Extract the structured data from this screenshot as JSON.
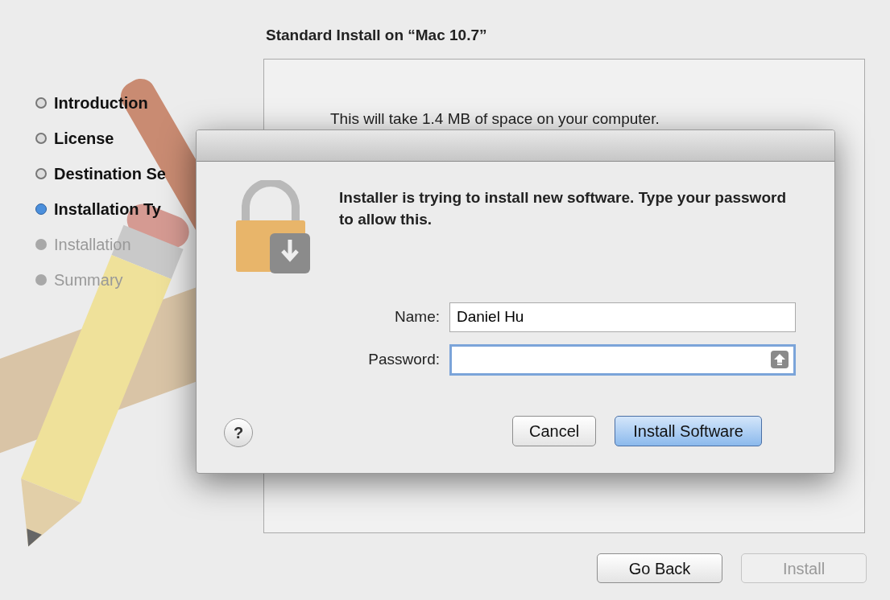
{
  "title": "Standard Install on “Mac 10.7”",
  "steps": [
    {
      "label": "Introduction",
      "selected": false,
      "disabled": false
    },
    {
      "label": "License",
      "selected": false,
      "disabled": false
    },
    {
      "label": "Destination Se",
      "selected": false,
      "disabled": false
    },
    {
      "label": "Installation Ty",
      "selected": true,
      "disabled": false
    },
    {
      "label": "Installation",
      "selected": false,
      "disabled": true
    },
    {
      "label": "Summary",
      "selected": false,
      "disabled": true
    }
  ],
  "content": {
    "text": "This will take 1.4 MB of space on your computer."
  },
  "buttons": [
    {
      "label": "Go Back",
      "disabled": false
    },
    {
      "label": "Install",
      "disabled": true
    }
  ],
  "dialog": {
    "message": "Installer is trying to install new software. Type your password to allow this.",
    "fields": [
      {
        "label": "Name:",
        "value": "Daniel Hu",
        "focused": false
      },
      {
        "label": "Password:",
        "focused": true
      }
    ],
    "help": "?",
    "buttons": [
      {
        "label": "Cancel",
        "default": false
      },
      {
        "label": "Install Software",
        "default": true
      }
    ]
  }
}
